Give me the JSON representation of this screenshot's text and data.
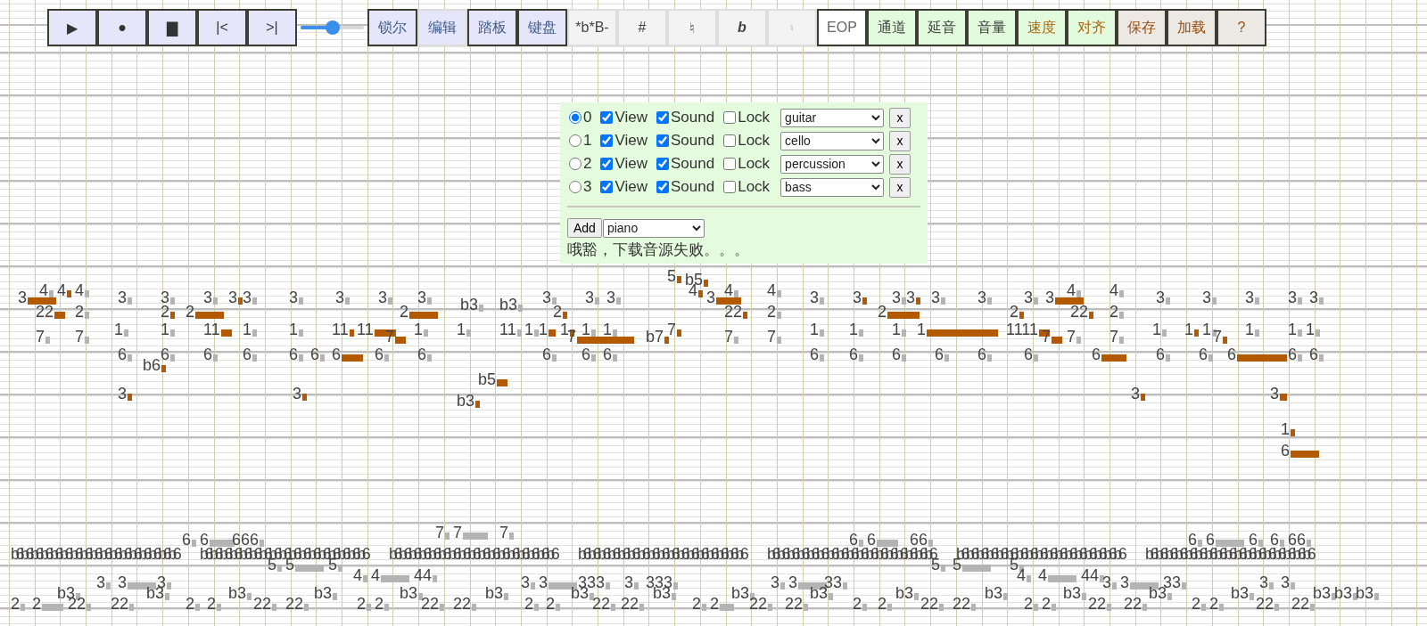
{
  "toolbar": {
    "items": [
      {
        "kind": "transport",
        "label": "▶",
        "on": true,
        "disabled": false
      },
      {
        "kind": "transport",
        "label": "●",
        "on": true,
        "disabled": false
      },
      {
        "kind": "transport",
        "label": "▇",
        "on": true,
        "disabled": false
      },
      {
        "kind": "transport",
        "label": "|<",
        "on": true,
        "disabled": false
      },
      {
        "kind": "transport",
        "label": ">|",
        "on": true,
        "disabled": false
      },
      {
        "kind": "slider",
        "level": 0.5
      },
      {
        "kind": "mode",
        "label": "锁尔",
        "on": true,
        "disabled": false
      },
      {
        "kind": "mode",
        "label": "编辑",
        "on": false,
        "disabled": false
      },
      {
        "kind": "mode",
        "label": "踏板",
        "on": true,
        "disabled": false
      },
      {
        "kind": "mode",
        "label": "键盘",
        "on": true,
        "disabled": false
      },
      {
        "kind": "accidental",
        "label": "*b*B-",
        "on": false,
        "disabled": false
      },
      {
        "kind": "accidental",
        "label": "#",
        "on": false,
        "disabled": false
      },
      {
        "kind": "accidental",
        "label": "♮",
        "on": false,
        "disabled": false
      },
      {
        "kind": "flat",
        "label": "b",
        "on": false,
        "disabled": false
      },
      {
        "kind": "accidental",
        "label": "♮",
        "on": false,
        "disabled": true
      },
      {
        "kind": "plain",
        "label": "EOP",
        "on": true,
        "disabled": false
      },
      {
        "kind": "channel",
        "label": "通道",
        "on": true,
        "disabled": false
      },
      {
        "kind": "channel",
        "label": "延音",
        "on": true,
        "disabled": false
      },
      {
        "kind": "channel",
        "label": "音量",
        "on": true,
        "disabled": false
      },
      {
        "kind": "tempo",
        "label": "速度",
        "on": true,
        "disabled": false
      },
      {
        "kind": "tempo",
        "label": "对齐",
        "on": true,
        "disabled": false
      },
      {
        "kind": "file",
        "label": "保存",
        "on": true,
        "disabled": false
      },
      {
        "kind": "file",
        "label": "加载",
        "on": true,
        "disabled": false
      },
      {
        "kind": "file",
        "label": "?",
        "on": true,
        "disabled": false
      }
    ]
  },
  "channel_panel": {
    "channels": [
      {
        "index": "0",
        "selected": true,
        "view": true,
        "view_label": "View",
        "sound": true,
        "sound_label": "Sound",
        "lock": false,
        "lock_label": "Lock",
        "instrument": "guitar",
        "remove_label": "x"
      },
      {
        "index": "1",
        "selected": false,
        "view": true,
        "view_label": "View",
        "sound": true,
        "sound_label": "Sound",
        "lock": false,
        "lock_label": "Lock",
        "instrument": "cello",
        "remove_label": "x"
      },
      {
        "index": "2",
        "selected": false,
        "view": true,
        "view_label": "View",
        "sound": true,
        "sound_label": "Sound",
        "lock": false,
        "lock_label": "Lock",
        "instrument": "percussion",
        "remove_label": "x"
      },
      {
        "index": "3",
        "selected": false,
        "view": true,
        "view_label": "View",
        "sound": true,
        "sound_label": "Sound",
        "lock": false,
        "lock_label": "Lock",
        "instrument": "bass",
        "remove_label": "x"
      }
    ],
    "add_label": "Add",
    "add_instrument": "piano",
    "message": "哦豁，下载音源失败。。。"
  },
  "roll": {
    "lanes": [
      {
        "notes": [
          {
            "label": "5",
            "color": "#b35a00"
          }
        ]
      },
      {
        "notes": [
          {
            "label": "b5",
            "color": "#b35a00"
          }
        ]
      },
      {
        "notes": [
          {
            "label": "4",
            "color": "#b4b4b4"
          },
          {
            "label": "4",
            "color": "#b35a00"
          },
          {
            "label": "4",
            "color": "#b4b4b4"
          },
          {
            "label": "4",
            "color": "#b35a00"
          },
          {
            "label": "4",
            "color": "#b4b4b4"
          },
          {
            "label": "4",
            "color": "#b4b4b4"
          },
          {
            "label": "4",
            "color": "#b4b4b4"
          },
          {
            "label": "4",
            "color": "#b4b4b4"
          }
        ]
      },
      {
        "notes": [
          {
            "label": "3",
            "color": "#b35a00"
          },
          {
            "label": "3",
            "color": "#b4b4b4"
          },
          {
            "label": "3",
            "color": "#b4b4b4"
          },
          {
            "label": "3",
            "color": "#b4b4b4"
          },
          {
            "label": "3",
            "color": "#b35a00"
          },
          {
            "label": "3",
            "color": "#b4b4b4"
          },
          {
            "label": "3",
            "color": "#b4b4b4"
          },
          {
            "label": "3",
            "color": "#b4b4b4"
          },
          {
            "label": "3",
            "color": "#b4b4b4"
          },
          {
            "label": "3",
            "color": "#b4b4b4"
          },
          {
            "label": "3",
            "color": "#b4b4b4"
          },
          {
            "label": "3",
            "color": "#b4b4b4"
          },
          {
            "label": "3",
            "color": "#b4b4b4"
          },
          {
            "label": "3",
            "color": "#b35a00"
          },
          {
            "label": "3",
            "color": "#b4b4b4"
          },
          {
            "label": "3",
            "color": "#b35a00"
          },
          {
            "label": "3",
            "color": "#b4b4b4"
          },
          {
            "label": "3",
            "color": "#b35a00"
          },
          {
            "label": "3",
            "color": "#b4b4b4"
          },
          {
            "label": "3",
            "color": "#b4b4b4"
          },
          {
            "label": "3",
            "color": "#b4b4b4"
          },
          {
            "label": "3",
            "color": "#b35a00"
          },
          {
            "label": "3",
            "color": "#b4b4b4"
          },
          {
            "label": "3",
            "color": "#b4b4b4"
          },
          {
            "label": "3",
            "color": "#b4b4b4"
          },
          {
            "label": "3",
            "color": "#b4b4b4"
          },
          {
            "label": "3",
            "color": "#b4b4b4"
          }
        ]
      },
      {
        "notes": [
          {
            "label": "b3",
            "color": "#b4b4b4"
          },
          {
            "label": "b3",
            "color": "#b4b4b4"
          }
        ]
      },
      {
        "notes": [
          {
            "label": "22",
            "color": "#b35a00"
          },
          {
            "label": "2",
            "color": "#b4b4b4"
          },
          {
            "label": "2",
            "color": "#b35a00"
          },
          {
            "label": "2",
            "color": "#b35a00"
          },
          {
            "label": "2",
            "color": "#b35a00"
          },
          {
            "label": "2",
            "color": "#b35a00"
          },
          {
            "label": "22",
            "color": "#b35a00"
          },
          {
            "label": "2",
            "color": "#b4b4b4"
          },
          {
            "label": "2",
            "color": "#b35a00"
          },
          {
            "label": "2",
            "color": "#b35a00"
          },
          {
            "label": "22",
            "color": "#b35a00"
          },
          {
            "label": "2",
            "color": "#b4b4b4"
          }
        ]
      },
      {
        "notes": [
          {
            "label": "1",
            "color": "#b4b4b4"
          },
          {
            "label": "1",
            "color": "#b4b4b4"
          },
          {
            "label": "11",
            "color": "#b35a00"
          },
          {
            "label": "1",
            "color": "#b4b4b4"
          },
          {
            "label": "1",
            "color": "#b4b4b4"
          },
          {
            "label": "11",
            "color": "#b35a00"
          },
          {
            "label": "11",
            "color": "#b35a00"
          },
          {
            "label": "1",
            "color": "#b4b4b4"
          },
          {
            "label": "1",
            "color": "#b4b4b4"
          },
          {
            "label": "11",
            "color": "#b4b4b4"
          },
          {
            "label": "1",
            "color": "#b4b4b4"
          },
          {
            "label": "1",
            "color": "#b35a00"
          },
          {
            "label": "1",
            "color": "#b35a00"
          },
          {
            "label": "1",
            "color": "#b4b4b4"
          },
          {
            "label": "1",
            "color": "#b4b4b4"
          },
          {
            "label": "7",
            "color": "#b35a00"
          },
          {
            "label": "1",
            "color": "#b4b4b4"
          },
          {
            "label": "1",
            "color": "#b4b4b4"
          },
          {
            "label": "1",
            "color": "#b4b4b4"
          },
          {
            "label": "1",
            "color": "#b35a00"
          },
          {
            "label": "1111",
            "color": "#b35a00"
          },
          {
            "label": "1",
            "color": "#b4b4b4"
          },
          {
            "label": "1",
            "color": "#b35a00"
          },
          {
            "label": "1",
            "color": "#b4b4b4"
          },
          {
            "label": "1",
            "color": "#b4b4b4"
          },
          {
            "label": "1",
            "color": "#b4b4b4"
          },
          {
            "label": "1",
            "color": "#b4b4b4"
          }
        ]
      },
      {
        "notes": [
          {
            "label": "7",
            "color": "#b4b4b4"
          },
          {
            "label": "7",
            "color": "#b4b4b4"
          },
          {
            "label": "7",
            "color": "#b35a00"
          },
          {
            "label": "7",
            "color": "#b35a00"
          },
          {
            "label": "b7",
            "color": "#b35a00"
          },
          {
            "label": "7",
            "color": "#b4b4b4"
          },
          {
            "label": "7",
            "color": "#b4b4b4"
          },
          {
            "label": "7",
            "color": "#b35a00"
          },
          {
            "label": "7",
            "color": "#b4b4b4"
          },
          {
            "label": "7",
            "color": "#b4b4b4"
          },
          {
            "label": "7",
            "color": "#b35a00"
          }
        ]
      },
      {
        "notes": [
          {
            "label": "6",
            "color": "#b4b4b4"
          },
          {
            "label": "6",
            "color": "#b4b4b4"
          },
          {
            "label": "6",
            "color": "#b4b4b4"
          },
          {
            "label": "6",
            "color": "#b4b4b4"
          },
          {
            "label": "6",
            "color": "#b4b4b4"
          },
          {
            "label": "6",
            "color": "#b4b4b4"
          },
          {
            "label": "6",
            "color": "#b35a00"
          },
          {
            "label": "6",
            "color": "#b4b4b4"
          },
          {
            "label": "6",
            "color": "#b4b4b4"
          },
          {
            "label": "6",
            "color": "#b4b4b4"
          },
          {
            "label": "6",
            "color": "#b4b4b4"
          },
          {
            "label": "6",
            "color": "#b4b4b4"
          },
          {
            "label": "6",
            "color": "#b4b4b4"
          },
          {
            "label": "6",
            "color": "#b4b4b4"
          },
          {
            "label": "6",
            "color": "#b4b4b4"
          },
          {
            "label": "6",
            "color": "#b4b4b4"
          },
          {
            "label": "6",
            "color": "#b4b4b4"
          },
          {
            "label": "6",
            "color": "#b4b4b4"
          },
          {
            "label": "6",
            "color": "#b35a00"
          },
          {
            "label": "6",
            "color": "#b4b4b4"
          },
          {
            "label": "6",
            "color": "#b4b4b4"
          },
          {
            "label": "6",
            "color": "#b35a00"
          },
          {
            "label": "6",
            "color": "#b4b4b4"
          },
          {
            "label": "6",
            "color": "#b4b4b4"
          }
        ]
      },
      {
        "notes": [
          {
            "label": "b6",
            "color": "#b35a00"
          }
        ]
      },
      {
        "notes": [
          {
            "label": "b5",
            "color": "#b35a00"
          }
        ]
      },
      {
        "notes": [
          {
            "label": "3",
            "color": "#b35a00"
          },
          {
            "label": "3",
            "color": "#b35a00"
          },
          {
            "label": "3",
            "color": "#b35a00"
          },
          {
            "label": "3",
            "color": "#b35a00"
          }
        ]
      },
      {
        "notes": [
          {
            "label": "b3",
            "color": "#b35a00"
          }
        ]
      },
      {
        "notes": [
          {
            "label": "1",
            "color": "#b35a00"
          }
        ]
      },
      {
        "notes": [
          {
            "label": "6",
            "color": "#b35a00"
          }
        ]
      },
      {
        "notes": [
          {
            "label": "7",
            "color": "#b4b4b4"
          },
          {
            "label": "7",
            "color": "#b4b4b4"
          },
          {
            "label": "7",
            "color": "#b4b4b4"
          }
        ]
      },
      {
        "notes": [
          {
            "label": "6",
            "color": "#b4b4b4"
          },
          {
            "label": "6",
            "color": "#b4b4b4"
          },
          {
            "label": "666",
            "color": "#b4b4b4"
          },
          {
            "label": "6",
            "color": "#b4b4b4"
          },
          {
            "label": "6",
            "color": "#b4b4b4"
          },
          {
            "label": "66",
            "color": "#b4b4b4"
          },
          {
            "label": "6",
            "color": "#b4b4b4"
          },
          {
            "label": "6",
            "color": "#b4b4b4"
          },
          {
            "label": "6",
            "color": "#b4b4b4"
          },
          {
            "label": "6",
            "color": "#b4b4b4"
          },
          {
            "label": "66",
            "color": "#b4b4b4"
          }
        ]
      },
      {
        "notes": [
          {
            "kind": "cluster",
            "label": "b6b6b6b6b6b6b6b6b6b6b6b6b6b6b6b6b6"
          },
          {
            "kind": "cluster",
            "label": "b6b6b6b6b6b6b6b6b6b6b6b6b6b6b6b6b6"
          },
          {
            "kind": "cluster",
            "label": "b6b6b6b6b6b6b6b6b6b6b6b6b6b6b6b6b6"
          },
          {
            "kind": "cluster",
            "label": "b6b6b6b6b6b6b6b6b6b6b6b6b6b6b6b6b6"
          },
          {
            "kind": "cluster",
            "label": "b6b6b6b6b6b6b6b6b6b6b6b6b6b6b6b6b6"
          },
          {
            "kind": "cluster",
            "label": "b6b6b6b6b6b6b6b6b6b6b6b6b6b6b6b6b6"
          },
          {
            "kind": "cluster",
            "label": "b6b6b6b6b6b6b6b6b6b6b6b6b6b6b6b6b6"
          }
        ]
      },
      {
        "notes": [
          {
            "label": "5",
            "color": "#b4b4b4"
          },
          {
            "label": "5",
            "color": "#b4b4b4"
          },
          {
            "label": "5",
            "color": "#b4b4b4"
          },
          {
            "label": "5",
            "color": "#b4b4b4"
          },
          {
            "label": "5",
            "color": "#b4b4b4"
          },
          {
            "label": "5",
            "color": "#b4b4b4"
          }
        ]
      },
      {
        "notes": [
          {
            "label": "4",
            "color": "#b4b4b4"
          },
          {
            "label": "4",
            "color": "#b4b4b4"
          },
          {
            "label": "44",
            "color": "#b4b4b4"
          },
          {
            "label": "4",
            "color": "#b4b4b4"
          },
          {
            "label": "4",
            "color": "#b4b4b4"
          },
          {
            "label": "44",
            "color": "#b4b4b4"
          }
        ]
      },
      {
        "notes": [
          {
            "label": "3",
            "color": "#b4b4b4"
          },
          {
            "label": "3",
            "color": "#b4b4b4"
          },
          {
            "label": "3",
            "color": "#b4b4b4"
          },
          {
            "label": "3",
            "color": "#b4b4b4"
          },
          {
            "label": "3",
            "color": "#b4b4b4"
          },
          {
            "label": "333",
            "color": "#b4b4b4"
          },
          {
            "label": "3",
            "color": "#b4b4b4"
          },
          {
            "label": "333",
            "color": "#b4b4b4"
          },
          {
            "label": "3",
            "color": "#b4b4b4"
          },
          {
            "label": "3",
            "color": "#b4b4b4"
          },
          {
            "label": "33",
            "color": "#b4b4b4"
          },
          {
            "label": "3",
            "color": "#b4b4b4"
          },
          {
            "label": "3",
            "color": "#b4b4b4"
          },
          {
            "label": "33",
            "color": "#b4b4b4"
          },
          {
            "label": "3",
            "color": "#b4b4b4"
          },
          {
            "label": "3",
            "color": "#b4b4b4"
          }
        ]
      },
      {
        "notes": [
          {
            "label": "b3",
            "color": "#b4b4b4"
          },
          {
            "label": "b3",
            "color": "#b4b4b4"
          },
          {
            "label": "b3",
            "color": "#b4b4b4"
          },
          {
            "label": "b3",
            "color": "#b4b4b4"
          },
          {
            "label": "b3",
            "color": "#b4b4b4"
          },
          {
            "label": "b3",
            "color": "#b4b4b4"
          },
          {
            "label": "b3",
            "color": "#b4b4b4"
          },
          {
            "label": "b3",
            "color": "#b4b4b4"
          },
          {
            "label": "b3",
            "color": "#b4b4b4"
          },
          {
            "label": "b3",
            "color": "#b4b4b4"
          },
          {
            "label": "b3",
            "color": "#b4b4b4"
          },
          {
            "label": "b3",
            "color": "#b4b4b4"
          },
          {
            "label": "b3",
            "color": "#b4b4b4"
          },
          {
            "label": "b3",
            "color": "#b4b4b4"
          },
          {
            "label": "b3",
            "color": "#b4b4b4"
          },
          {
            "label": "b3",
            "color": "#b4b4b4"
          },
          {
            "label": "b3",
            "color": "#b4b4b4"
          },
          {
            "label": "b3",
            "color": "#b4b4b4"
          }
        ]
      },
      {
        "notes": [
          {
            "label": "2",
            "color": "#b4b4b4"
          },
          {
            "label": "2",
            "color": "#b4b4b4"
          },
          {
            "label": "22",
            "color": "#b4b4b4"
          },
          {
            "label": "22",
            "color": "#b4b4b4"
          },
          {
            "label": "2",
            "color": "#b4b4b4"
          },
          {
            "label": "2",
            "color": "#b4b4b4"
          },
          {
            "label": "22",
            "color": "#b4b4b4"
          },
          {
            "label": "22",
            "color": "#b4b4b4"
          },
          {
            "label": "2",
            "color": "#b4b4b4"
          },
          {
            "label": "2",
            "color": "#b4b4b4"
          },
          {
            "label": "22",
            "color": "#b4b4b4"
          },
          {
            "label": "22",
            "color": "#b4b4b4"
          },
          {
            "label": "2",
            "color": "#b4b4b4"
          },
          {
            "label": "2",
            "color": "#b4b4b4"
          },
          {
            "label": "22",
            "color": "#b4b4b4"
          },
          {
            "label": "22",
            "color": "#b4b4b4"
          },
          {
            "label": "2",
            "color": "#b4b4b4"
          },
          {
            "label": "2",
            "color": "#b4b4b4"
          },
          {
            "label": "22",
            "color": "#b4b4b4"
          },
          {
            "label": "22",
            "color": "#b4b4b4"
          },
          {
            "label": "2",
            "color": "#b4b4b4"
          },
          {
            "label": "2",
            "color": "#b4b4b4"
          },
          {
            "label": "22",
            "color": "#b4b4b4"
          },
          {
            "label": "22",
            "color": "#b4b4b4"
          },
          {
            "label": "2",
            "color": "#b4b4b4"
          },
          {
            "label": "2",
            "color": "#b4b4b4"
          },
          {
            "label": "22",
            "color": "#b4b4b4"
          },
          {
            "label": "22",
            "color": "#b4b4b4"
          },
          {
            "label": "2",
            "color": "#b4b4b4"
          },
          {
            "label": "2",
            "color": "#b4b4b4"
          },
          {
            "label": "22",
            "color": "#b4b4b4"
          },
          {
            "label": "22",
            "color": "#b4b4b4"
          }
        ]
      }
    ]
  }
}
